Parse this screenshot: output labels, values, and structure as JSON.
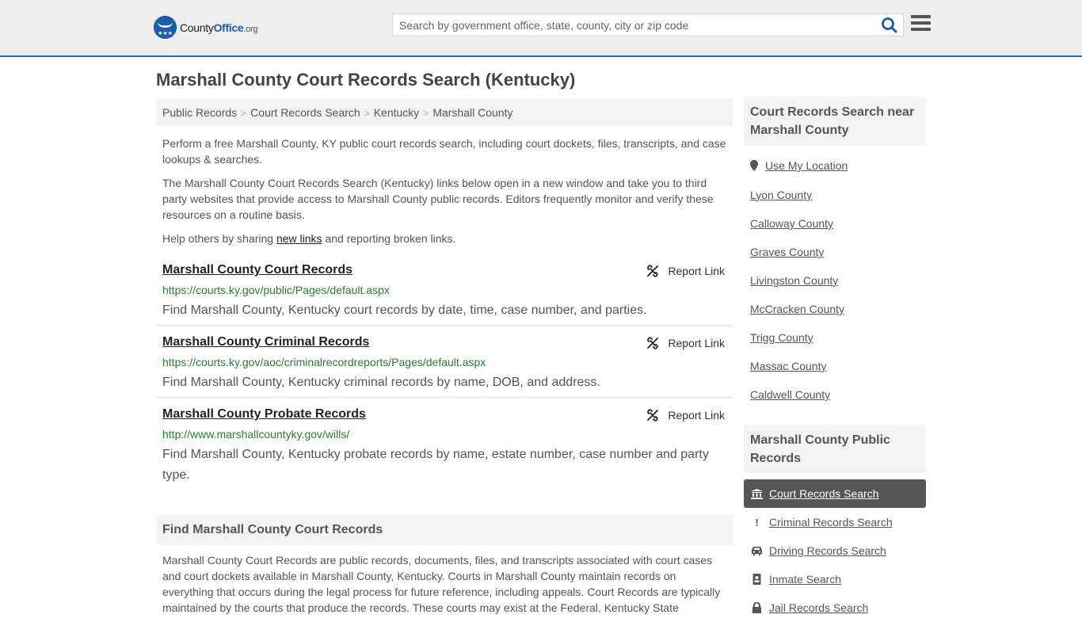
{
  "header": {
    "logo": {
      "county": "County",
      "office": "Office",
      "org": ".org"
    },
    "search": {
      "placeholder": "Search by government office, state, county, city or zip code",
      "value": ""
    },
    "colors": {
      "accent": "#2c6fb3",
      "brand": "#1a5ea8"
    }
  },
  "page": {
    "title": "Marshall County Court Records Search (Kentucky)",
    "breadcrumb": [
      "Public Records",
      "Court Records Search",
      "Kentucky",
      "Marshall County"
    ],
    "intro": {
      "p1": "Perform a free Marshall County, KY public court records search, including court dockets, files, transcripts, and case lookups & searches.",
      "p2": "The Marshall County Court Records Search (Kentucky) links below open in a new window and take you to third party websites that provide access to Marshall County public records. Editors frequently monitor and verify these resources on a routine basis.",
      "p3_before": "Help others by sharing ",
      "p3_link": "new links",
      "p3_after": " and reporting broken links."
    },
    "records": [
      {
        "title": "Marshall County Court Records",
        "url": "https://courts.ky.gov/public/Pages/default.aspx",
        "description": "Find Marshall County, Kentucky court records by date, time, case number, and parties.",
        "report_label": "Report Link"
      },
      {
        "title": "Marshall County Criminal Records",
        "url": "https://courts.ky.gov/aoc/criminalrecordreports/Pages/default.aspx",
        "description": "Find Marshall County, Kentucky criminal records by name, DOB, and address.",
        "report_label": "Report Link"
      },
      {
        "title": "Marshall County Probate Records",
        "url": "http://www.marshallcountyky.gov/wills/",
        "description": "Find Marshall County, Kentucky probate records by name, estate number, case number and party type.",
        "report_label": "Report Link"
      }
    ],
    "find_section": {
      "heading": "Find Marshall County Court Records",
      "body": "Marshall County Court Records are public records, documents, files, and transcripts associated with court cases and court dockets available in Marshall County, Kentucky. Courts in Marshall County maintain records on everything that occurs during the legal process for future reference, including appeals. Court Records are typically maintained by the courts that produce the records. These courts may exist at the Federal, Kentucky State"
    }
  },
  "sidebar": {
    "nearby_heading": "Court Records Search near Marshall County",
    "use_location": "Use My Location",
    "nearby": [
      "Lyon County",
      "Calloway County",
      "Graves County",
      "Livingston County",
      "McCracken County",
      "Trigg County",
      "Massac County",
      "Caldwell County"
    ],
    "public_records_heading": "Marshall County Public Records",
    "public_records": [
      {
        "label": "Court Records Search",
        "icon": "institution-icon",
        "active": true
      },
      {
        "label": "Criminal Records Search",
        "icon": "exclamation-icon",
        "active": false
      },
      {
        "label": "Driving Records Search",
        "icon": "car-icon",
        "active": false
      },
      {
        "label": "Inmate Search",
        "icon": "id-badge-icon",
        "active": false
      },
      {
        "label": "Jail Records Search",
        "icon": "lock-icon",
        "active": false
      }
    ]
  }
}
